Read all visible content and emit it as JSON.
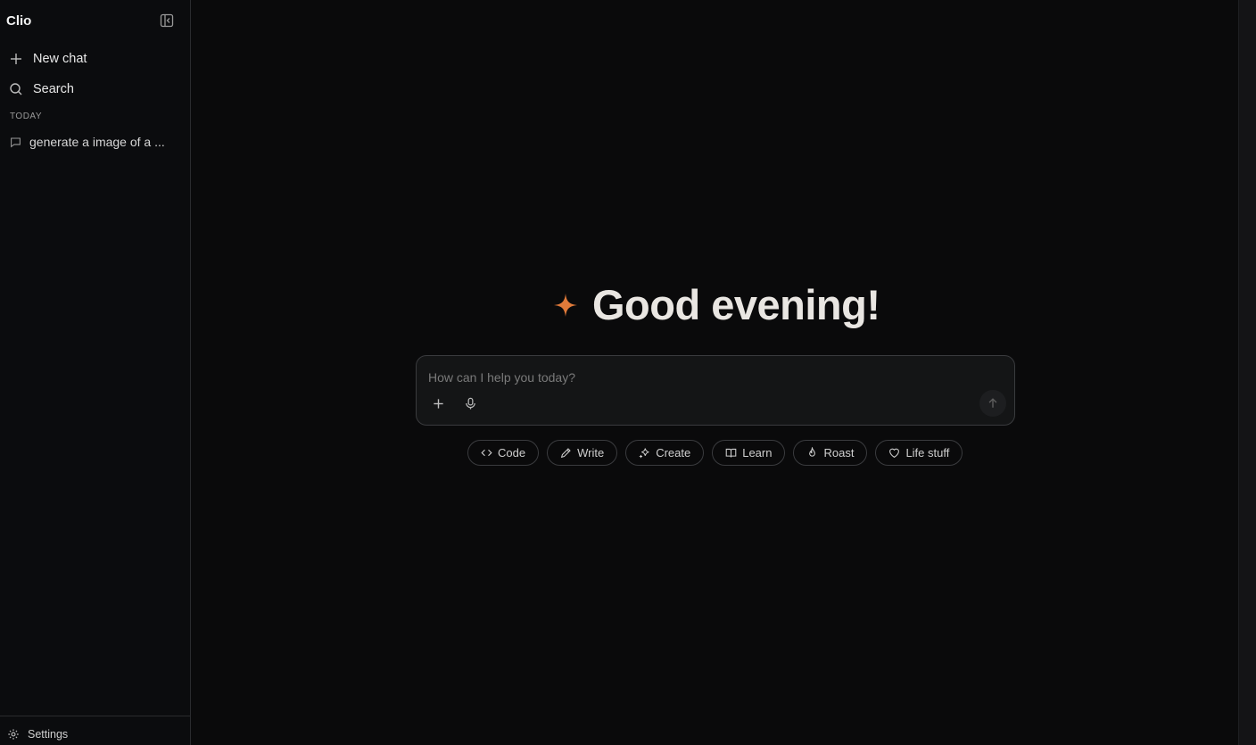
{
  "sidebar": {
    "brand": "Clio",
    "new_chat": "New chat",
    "search": "Search",
    "section_label": "TODAY",
    "chats": [
      "generate a image of a ..."
    ],
    "settings": "Settings"
  },
  "main": {
    "greeting": "Good evening!",
    "accent_color": "#e07a3a",
    "composer": {
      "placeholder": "How can I help you today?",
      "value": ""
    },
    "chips": [
      "Code",
      "Write",
      "Create",
      "Learn",
      "Roast",
      "Life stuff"
    ]
  }
}
